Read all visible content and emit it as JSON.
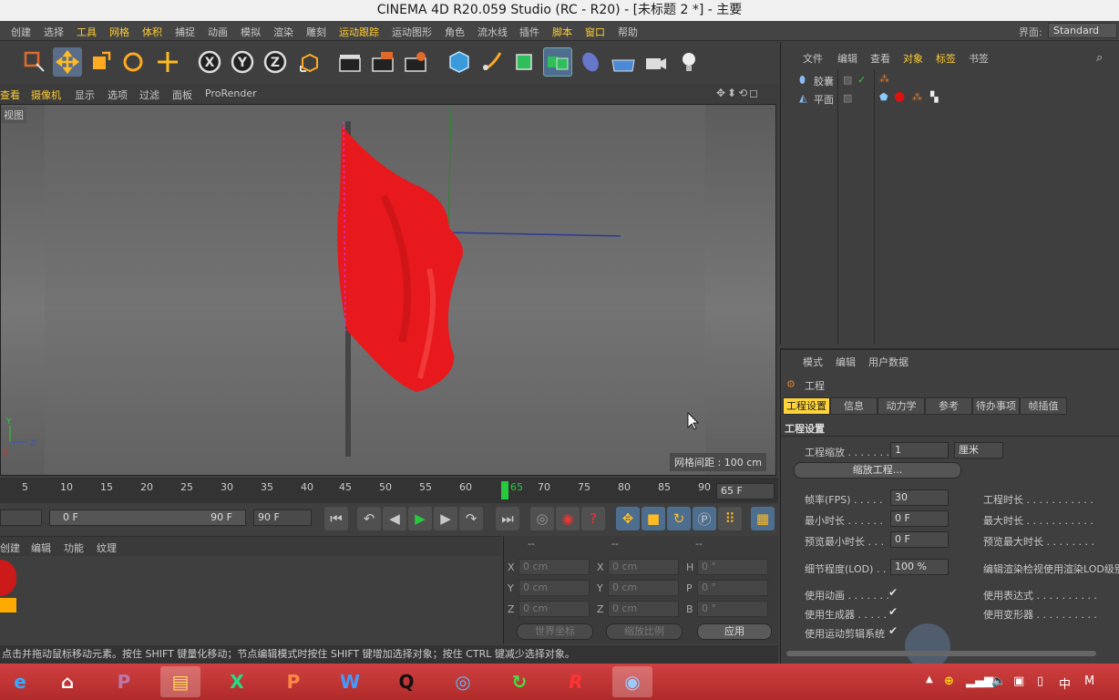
{
  "window": {
    "title": "CINEMA 4D R20.059 Studio (RC - R20) - [未标题 2 *] - 主要"
  },
  "menu": {
    "items": [
      "创建",
      "选择",
      "工具",
      "网格",
      "体积",
      "捕捉",
      "动画",
      "模拟",
      "渲染",
      "雕刻",
      "运动跟踪",
      "运动图形",
      "角色",
      "流水线",
      "插件",
      "脚本",
      "窗口",
      "帮助"
    ],
    "interface_label": "界面:",
    "interface_value": "Standard"
  },
  "viewport_menu": {
    "items": [
      "查看",
      "摄像机",
      "显示",
      "选项",
      "过滤",
      "面板",
      "ProRender"
    ]
  },
  "viewport": {
    "name": "视图",
    "grid_distance": "网格间距 : 100 cm"
  },
  "timeline": {
    "ticks": [
      "5",
      "10",
      "15",
      "20",
      "25",
      "30",
      "35",
      "40",
      "45",
      "50",
      "55",
      "60",
      "65",
      "70",
      "75",
      "80",
      "85",
      "90"
    ],
    "current_frame": "65 F",
    "playhead_frame": 65
  },
  "transport": {
    "range_start": "0 F",
    "range_end": "90 F",
    "end_frame": "90 F"
  },
  "material_menu": {
    "items": [
      "创建",
      "编辑",
      "功能",
      "纹理"
    ]
  },
  "coordinates": {
    "headers": [
      "--",
      "--",
      "--"
    ],
    "rows": [
      {
        "a": "X",
        "pos": "0 cm",
        "b": "X",
        "size": "0 cm",
        "c": "H",
        "rot": "0 °"
      },
      {
        "a": "Y",
        "pos": "0 cm",
        "b": "Y",
        "size": "0 cm",
        "c": "P",
        "rot": "0 °"
      },
      {
        "a": "Z",
        "pos": "0 cm",
        "b": "Z",
        "size": "0 cm",
        "c": "B",
        "rot": "0 °"
      }
    ],
    "world_coord": "世界坐标",
    "scale_ratio": "缩放比例",
    "apply": "应用"
  },
  "status": {
    "text": "点击并拖动鼠标移动元素。按住 SHIFT 键量化移动；节点编辑模式时按住 SHIFT 键增加选择对象；按住 CTRL 键减少选择对象。"
  },
  "objects_panel": {
    "menu": [
      "文件",
      "编辑",
      "查看",
      "对象",
      "标签",
      "书签"
    ],
    "objects": [
      {
        "name": "胶囊",
        "icon": "capsule-icon"
      },
      {
        "name": "平面",
        "icon": "plane-icon"
      }
    ]
  },
  "attributes_panel": {
    "menu": [
      "模式",
      "编辑",
      "用户数据"
    ],
    "object_label": "工程",
    "tabs": [
      "工程设置",
      "信息",
      "动力学",
      "参考",
      "待办事项",
      "帧插值"
    ],
    "active_tab": "工程设置",
    "section": "工程设置",
    "scale_label": "工程缩放 . . . . . . .",
    "scale_value": "1",
    "scale_unit": "厘米",
    "scale_button": "缩放工程...",
    "fps_label": "帧率(FPS) . . . . .",
    "fps_value": "30",
    "min_time_label": "最小时长 . . . . . .",
    "min_time_value": "0 F",
    "preview_min_label": "预览最小时长 . . .",
    "preview_min_value": "0 F",
    "lod_label": "细节程度(LOD) . .",
    "lod_value": "100 %",
    "project_time_label": "工程时长 . . . . . . . . . . .",
    "max_time_label": "最大时长 . . . . . . . . . . .",
    "preview_max_label": "预览最大时长 . . . . . . . .",
    "lod_render_label": "编辑渲染检视使用渲染LOD级别",
    "use_anim_label": "使用动画 . . . . . . .",
    "use_expr_label": "使用表达式 . . . . . . . . . .",
    "use_gen_label": "使用生成器 . . . . .",
    "use_deform_label": "使用变形器 . . . . . . . . . .",
    "use_motion_label": "使用运动剪辑系统",
    "check": "✔"
  },
  "taskbar": {
    "apps": [
      "e",
      "⌂",
      "P",
      "▤",
      "X",
      "P",
      "W",
      "Q",
      "◎",
      "↻",
      "R",
      "◉"
    ],
    "tray": {
      "lang": "中",
      "ime": "M"
    }
  },
  "colors": {
    "accent": "#ffd43a",
    "flag": "#e8191c",
    "taskbar": "#c03535",
    "playhead": "#27c93f"
  }
}
